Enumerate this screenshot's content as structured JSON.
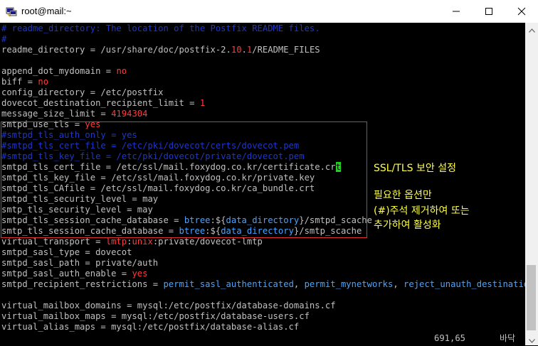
{
  "window": {
    "title": "root@mail:~"
  },
  "terminal": {
    "lines": [
      [
        {
          "t": "# readme_directory: The location of the Postfix README files.",
          "c": "c"
        }
      ],
      [
        {
          "t": "#",
          "c": "c"
        }
      ],
      [
        {
          "t": "readme_directory = /usr/share/doc/postfix-2.",
          "c": "k"
        },
        {
          "t": "10",
          "c": "v"
        },
        {
          "t": ".",
          "c": "k"
        },
        {
          "t": "1",
          "c": "v"
        },
        {
          "t": "/README_FILES",
          "c": "k"
        }
      ],
      [],
      [
        {
          "t": "append_dot_mydomain = ",
          "c": "k"
        },
        {
          "t": "no",
          "c": "v"
        }
      ],
      [
        {
          "t": "biff = ",
          "c": "k"
        },
        {
          "t": "no",
          "c": "v"
        }
      ],
      [
        {
          "t": "config_directory = /etc/postfix",
          "c": "k"
        }
      ],
      [
        {
          "t": "dovecot_destination_recipient_limit = ",
          "c": "k"
        },
        {
          "t": "1",
          "c": "v"
        }
      ],
      [
        {
          "t": "message_size_limit = ",
          "c": "k"
        },
        {
          "t": "4194304",
          "c": "v"
        }
      ],
      [
        {
          "t": "smtpd_use_tls = ",
          "c": "k"
        },
        {
          "t": "yes",
          "c": "v"
        }
      ],
      [
        {
          "t": "#smtpd_tls_auth_only = yes",
          "c": "c"
        }
      ],
      [
        {
          "t": "#smtpd_tls_cert_file = /etc/pki/dovecot/certs/dovecot.pem",
          "c": "c"
        }
      ],
      [
        {
          "t": "#smtpd_tls_key_file = /etc/pki/dovecot/private/dovecot.pem",
          "c": "c"
        }
      ],
      [
        {
          "t": "smtpd_tls_cert_file = /etc/ssl/mail.foxydog.co.kr/certificate.cr",
          "c": "k"
        },
        {
          "t": "t",
          "c": "cur"
        }
      ],
      [
        {
          "t": "smtpd_tls_key_file = /etc/ssl/mail.foxydog.co.kr/private.key",
          "c": "k"
        }
      ],
      [
        {
          "t": "smtpd_tls_CAfile = /etc/ssl/mail.foxydog.co.kr/ca_bundle.crt",
          "c": "k"
        }
      ],
      [
        {
          "t": "smtpd_tls_security_level = may",
          "c": "k"
        }
      ],
      [
        {
          "t": "smtp_tls_security_level = may",
          "c": "k"
        }
      ],
      [
        {
          "t": "smtpd_tls_session_cache_database = ",
          "c": "k"
        },
        {
          "t": "btree",
          "c": "s"
        },
        {
          "t": ":${",
          "c": "k"
        },
        {
          "t": "data_directory",
          "c": "s"
        },
        {
          "t": "}/smtpd_scache",
          "c": "k"
        }
      ],
      [
        {
          "t": "smtp_tls_session_cache_database = ",
          "c": "k"
        },
        {
          "t": "btree",
          "c": "s"
        },
        {
          "t": ":${",
          "c": "k"
        },
        {
          "t": "data_directory",
          "c": "s"
        },
        {
          "t": "}/smtp_scache",
          "c": "k"
        }
      ],
      [
        {
          "t": "virtual_transport = ",
          "c": "k"
        },
        {
          "t": "lmtp",
          "c": "v"
        },
        {
          "t": ":",
          "c": "k"
        },
        {
          "t": "unix",
          "c": "v"
        },
        {
          "t": ":private/dovecot-lmtp",
          "c": "k"
        }
      ],
      [
        {
          "t": "smtpd_sasl_type = dovecot",
          "c": "k"
        }
      ],
      [
        {
          "t": "smtpd_sasl_path = private/auth",
          "c": "k"
        }
      ],
      [
        {
          "t": "smtpd_sasl_auth_enable = ",
          "c": "k"
        },
        {
          "t": "yes",
          "c": "v"
        }
      ],
      [
        {
          "t": "smtpd_recipient_restrictions = ",
          "c": "k"
        },
        {
          "t": "permit_sasl_authenticated",
          "c": "s"
        },
        {
          "t": ", ",
          "c": "k"
        },
        {
          "t": "permit_mynetworks",
          "c": "s"
        },
        {
          "t": ", ",
          "c": "k"
        },
        {
          "t": "reject_unauth_destination",
          "c": "s"
        }
      ],
      [],
      [
        {
          "t": "virtual_mailbox_domains = mysql:/etc/postfix/database-domains.cf",
          "c": "k"
        }
      ],
      [
        {
          "t": "virtual_mailbox_maps = mysql:/etc/postfix/database-users.cf",
          "c": "k"
        }
      ],
      [
        {
          "t": "virtual_alias_maps = mysql:/etc/postfix/database-alias.cf",
          "c": "k"
        }
      ]
    ],
    "status_position": "691,65",
    "status_bottom": "바닥"
  },
  "annotation": {
    "title": "SSL/TLS 보안 설정",
    "body_line1": "필요한 옵션만",
    "body_line2": "(#)주석 제거하여 또는",
    "body_line3": "추가하여 활성화"
  },
  "colors": {
    "keys": "#c0c0c0",
    "values": "#ff3b3b",
    "comments": "#1f37c8",
    "special": "#4aa4ff",
    "cursor": "#21d221",
    "annotation": "#ffff40",
    "highlight_border": "#e03030"
  },
  "icons": {
    "app": "putty-terminal-icon",
    "minimize": "minimize-icon",
    "maximize": "maximize-icon",
    "close": "close-icon",
    "scroll_up": "chevron-up-icon",
    "scroll_down": "chevron-down-icon"
  }
}
